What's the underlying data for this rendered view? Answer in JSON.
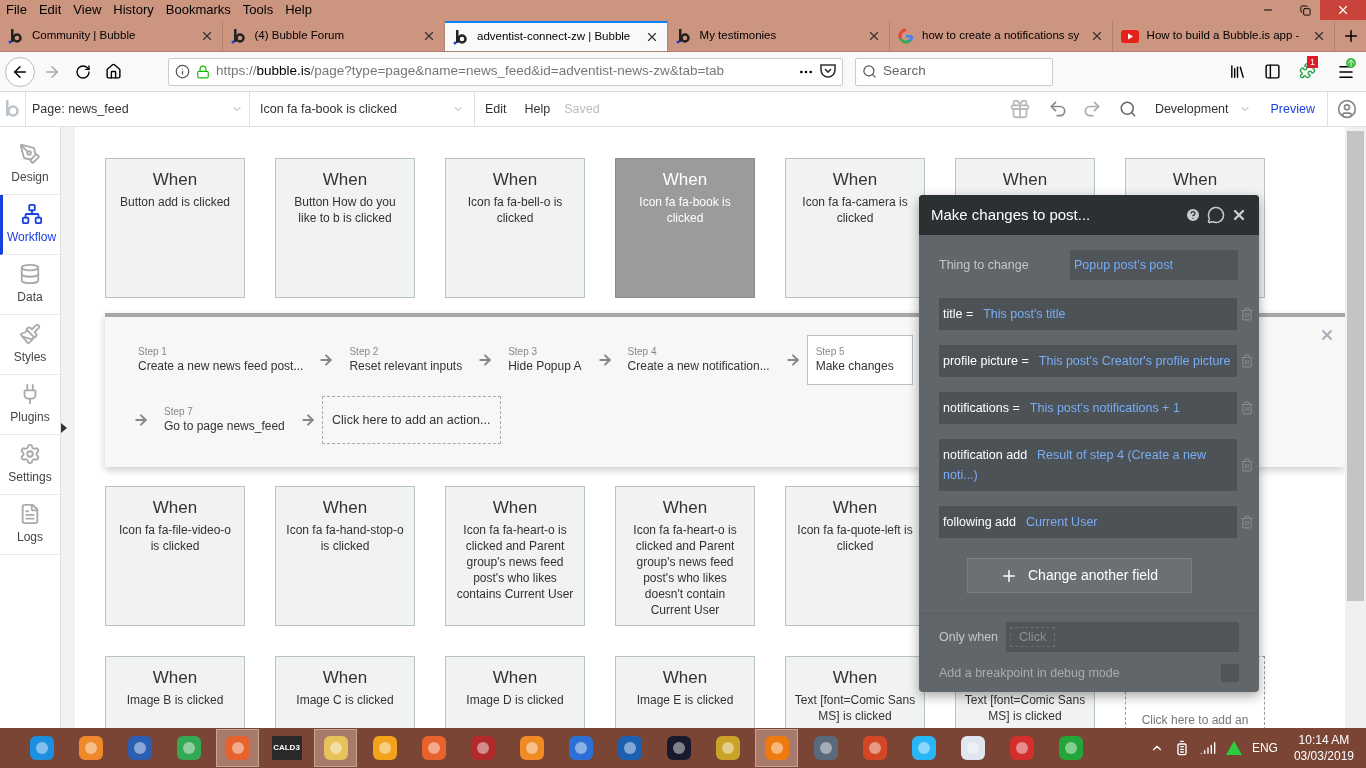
{
  "menu_bar": [
    "File",
    "Edit",
    "View",
    "History",
    "Bookmarks",
    "Tools",
    "Help"
  ],
  "tabs": [
    {
      "title": "Community | Bubble",
      "kind": "bubble",
      "selected": false
    },
    {
      "title": "(4) Bubble Forum",
      "kind": "bubble",
      "selected": false
    },
    {
      "title": "adventist-connect-zw | Bubble",
      "kind": "bubble",
      "selected": true
    },
    {
      "title": "My testimonies",
      "kind": "bubble",
      "selected": false
    },
    {
      "title": "how to create a notifications sy",
      "kind": "google",
      "selected": false
    },
    {
      "title": "How to build a Bubble.is app -",
      "kind": "youtube",
      "selected": false
    }
  ],
  "address_bar": {
    "scheme": "https://",
    "host": "bubble.is",
    "path": "/page?type=page&name=news_feed&id=adventist-news-zw&tab=tab"
  },
  "search": {
    "placeholder": "Search"
  },
  "extension_badge": "1",
  "editor_toolbar": {
    "page": "Page: news_feed",
    "event": "Icon fa fa-book is clicked",
    "menu": [
      "Edit",
      "Help"
    ],
    "status": "Saved",
    "mode": "Development",
    "preview": "Preview"
  },
  "sidebar": [
    {
      "label": "Design",
      "selected": false
    },
    {
      "label": "Workflow",
      "selected": true
    },
    {
      "label": "Data",
      "selected": false
    },
    {
      "label": "Styles",
      "selected": false
    },
    {
      "label": "Plugins",
      "selected": false
    },
    {
      "label": "Settings",
      "selected": false
    },
    {
      "label": "Logs",
      "selected": false
    }
  ],
  "event_rows": [
    [
      {
        "kind": "event",
        "title": "When",
        "description": "Button add is clicked",
        "selected": false
      },
      {
        "kind": "event",
        "title": "When",
        "description": "Button How do you like to b is clicked",
        "selected": false
      },
      {
        "kind": "event",
        "title": "When",
        "description": "Icon fa fa-bell-o is clicked",
        "selected": false
      },
      {
        "kind": "event",
        "title": "When",
        "description": "Icon fa fa-book is clicked",
        "selected": true
      },
      {
        "kind": "event",
        "title": "When",
        "description": "Icon fa fa-camera is clicked",
        "selected": false
      },
      {
        "kind": "event",
        "title": "When"
      },
      {
        "kind": "event",
        "title": "When"
      }
    ],
    [
      {
        "kind": "event",
        "title": "When",
        "description": "Icon fa fa-file-video-o is clicked",
        "selected": false
      },
      {
        "kind": "event",
        "title": "When",
        "description": "Icon fa fa-hand-stop-o is clicked",
        "selected": false
      },
      {
        "kind": "event",
        "title": "When",
        "description": "Icon fa fa-heart-o is clicked and Parent group's news feed post's who likes contains Current User",
        "selected": false
      },
      {
        "kind": "event",
        "title": "When",
        "description": "Icon fa fa-heart-o is clicked and Parent group's news feed post's who likes doesn't contain Current User",
        "selected": false
      },
      {
        "kind": "event",
        "title": "When",
        "description": "Icon fa fa-quote-left is clicked",
        "selected": false
      }
    ],
    [
      {
        "kind": "event",
        "title": "When",
        "description": "Image B is clicked",
        "selected": false
      },
      {
        "kind": "event",
        "title": "When",
        "description": "Image C is clicked",
        "selected": false
      },
      {
        "kind": "event",
        "title": "When",
        "description": "Image D is clicked",
        "selected": false
      },
      {
        "kind": "event",
        "title": "When",
        "description": "Image E is clicked",
        "selected": false
      },
      {
        "kind": "event",
        "title": "When",
        "description": "Text [font=Comic Sans MS] is clicked",
        "selected": false
      },
      {
        "kind": "event",
        "description": "Text [font=Comic Sans MS] is clicked"
      },
      {
        "kind": "add",
        "description": "Click here to add an"
      }
    ]
  ],
  "step_rows": [
    [
      {
        "label": "Step 1",
        "action": "Create a new news feed post...",
        "selected": false
      },
      {
        "label": "Step 2",
        "action": "Reset relevant inputs",
        "selected": false
      },
      {
        "label": "Step 3",
        "action": "Hide Popup A",
        "selected": false
      },
      {
        "label": "Step 4",
        "action": "Create a new notification...",
        "selected": false
      },
      {
        "label": "Step 5",
        "action": "Make changes",
        "selected": true
      }
    ],
    [
      {
        "label": "Step 7",
        "action": "Go to page news_feed",
        "selected": false
      }
    ]
  ],
  "add_action": "Click here to add an action...",
  "popup": {
    "title": "Make changes to post...",
    "thing_label": "Thing to change",
    "thing_value": "Popup post's post",
    "fields": [
      {
        "name": "title =",
        "value": "This post's title"
      },
      {
        "name": "profile picture =",
        "value": "This post's Creator's profile picture"
      },
      {
        "name": "notifications =",
        "value": "This post's notifications + 1"
      },
      {
        "name": "notification add",
        "value": "Result of step 4 (Create a new noti...)"
      },
      {
        "name": "following add",
        "value": "Current User"
      }
    ],
    "add_field": "Change another field",
    "only_when_label": "Only when",
    "only_when_placeholder": "Click",
    "breakpoint_label": "Add a breakpoint in debug mode",
    "breakpoint_checked": false
  },
  "taskbar": {
    "apps": [
      {
        "color": "#1b8fe0",
        "selected": false
      },
      {
        "color": "#f0892a",
        "selected": false
      },
      {
        "color": "#2b5fb4",
        "selected": false
      },
      {
        "color": "#34a853",
        "selected": false
      },
      {
        "color": "#e8632b",
        "selected": true
      },
      {
        "color": "#2a2a2a",
        "selected": false,
        "label": "CALD3"
      },
      {
        "color": "#e8c15a",
        "selected": true
      },
      {
        "color": "#f2a31b",
        "selected": false
      },
      {
        "color": "#e8622a",
        "selected": false
      },
      {
        "color": "#b02a2a",
        "selected": false
      },
      {
        "color": "#f08a24",
        "selected": false
      },
      {
        "color": "#2c6fd6",
        "selected": false
      },
      {
        "color": "#1d5fb0",
        "selected": false
      },
      {
        "color": "#1a1a2e",
        "selected": false
      },
      {
        "color": "#c9a227",
        "selected": false
      },
      {
        "color": "#f07a10",
        "selected": true
      },
      {
        "color": "#5a6a7a",
        "selected": false
      },
      {
        "color": "#d24726",
        "selected": false
      },
      {
        "color": "#29b6f6",
        "selected": false
      },
      {
        "color": "#dfe6ee",
        "selected": false
      },
      {
        "color": "#d32f2f",
        "selected": false
      },
      {
        "color": "#22a63a",
        "selected": false
      }
    ],
    "language": "ENG",
    "time": "10:14 AM",
    "date": "03/03/2019"
  }
}
